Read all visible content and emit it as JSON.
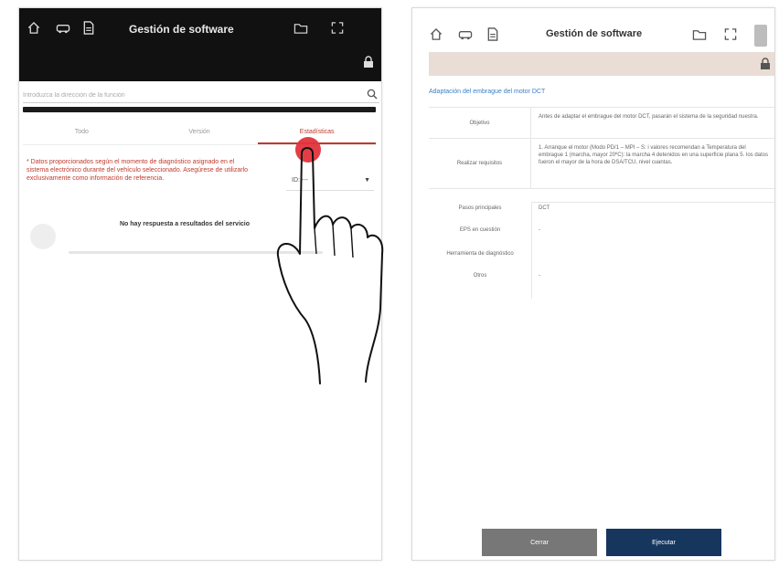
{
  "left": {
    "title": "Gestión de software",
    "search": {
      "placeholder": "Introduzca la dirección de la función"
    },
    "tabs": [
      {
        "label": "Todo"
      },
      {
        "label": "Versión"
      },
      {
        "label": "Estadísticas"
      }
    ],
    "notice": "* Datos proporcionados según el momento de diagnóstico asignado en el sistema electrónico durante del vehículo seleccionado. Asegúrese de utilizarlo exclusivamente como información de referencia.",
    "select_value": "ID: ---",
    "empty_message": "No hay respuesta a resultados del servicio",
    "colors": {
      "accent": "#c0392b",
      "header_bg": "#111111",
      "touch": "#e2333c"
    },
    "icons": [
      "home-icon",
      "vehicle-scan-icon",
      "document-icon",
      "folder-icon",
      "expand-icon",
      "lock-icon",
      "search-icon",
      "chevron-down-icon",
      "pointing-hand-icon"
    ]
  },
  "right": {
    "title": "Gestión de software",
    "section_title": "Adaptación del embrague del motor DCT",
    "rows": [
      {
        "key": "Objetivo",
        "value": "Antes de adaptar el embrague del motor DCT, pasarán el sistema de la seguridad nuestra."
      },
      {
        "key": "Realizar requisitos",
        "value": "1. Arranque el motor (Modo PD/1 – MPI – S: i valores recomendan a Temperatura del embrague 1 (marcha, mayor 20ºC): la marcha 4 detenidos en una superficie plana 5. los datos fueron el mayor de la hora de DSA/TCU, nivel cuantas."
      }
    ],
    "details": [
      {
        "key": "Pasos principales",
        "value": "DCT"
      },
      {
        "key": "EPS en cuestión",
        "value": "-"
      },
      {
        "key": "Herramienta de diagnóstico",
        "value": ""
      },
      {
        "key": "Otros",
        "value": "-"
      }
    ],
    "buttons": {
      "cancel": "Cerrar",
      "run": "Ejecutar"
    },
    "colors": {
      "band": "#e9ddd5",
      "section": "#3b7fc4",
      "run_button": "#16365e",
      "cancel_button": "#777777"
    },
    "icons": [
      "home-icon",
      "vehicle-scan-icon",
      "document-icon",
      "folder-icon",
      "expand-icon",
      "lock-icon"
    ]
  }
}
